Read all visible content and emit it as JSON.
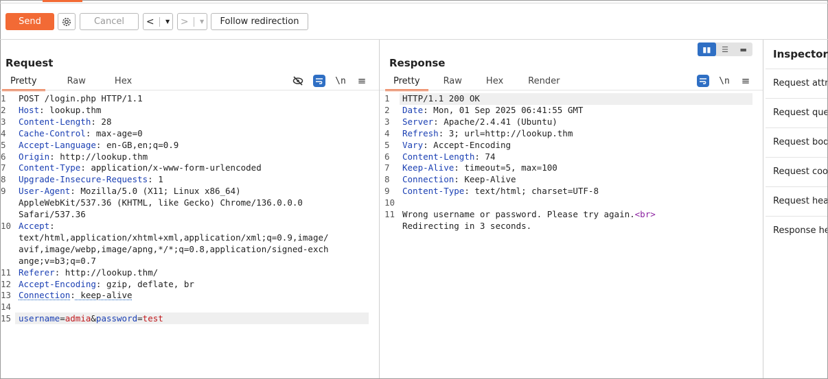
{
  "toolbar": {
    "send_label": "Send",
    "cancel_label": "Cancel",
    "prev_label": "<",
    "next_label": ">",
    "follow_label": "Follow redirection"
  },
  "request": {
    "title": "Request",
    "tabs": [
      "Pretty",
      "Raw",
      "Hex"
    ],
    "icons": [
      "eye-slash-icon",
      "wrap-icon",
      "newline-icon",
      "menu-icon"
    ],
    "newline_label": "\\n",
    "lines": [
      {
        "num": "1",
        "text": "POST /login.php HTTP/1.1"
      },
      {
        "num": "2",
        "key": "Host",
        "value": " lookup.thm"
      },
      {
        "num": "3",
        "key": "Content-Length",
        "value": " 28"
      },
      {
        "num": "4",
        "key": "Cache-Control",
        "value": " max-age=0"
      },
      {
        "num": "5",
        "key": "Accept-Language",
        "value": " en-GB,en;q=0.9"
      },
      {
        "num": "6",
        "key": "Origin",
        "value": " http://lookup.thm"
      },
      {
        "num": "7",
        "key": "Content-Type",
        "value": " application/x-www-form-urlencoded"
      },
      {
        "num": "8",
        "key": "Upgrade-Insecure-Requests",
        "value": " 1"
      },
      {
        "num": "9",
        "key": "User-Agent",
        "value": " Mozilla/5.0 (X11; Linux x86_64)"
      },
      {
        "num": "",
        "text": "AppleWebKit/537.36 (KHTML, like Gecko) Chrome/136.0.0.0"
      },
      {
        "num": "",
        "text": "Safari/537.36"
      },
      {
        "num": "10",
        "key": "Accept",
        "value": ""
      },
      {
        "num": "",
        "text": "text/html,application/xhtml+xml,application/xml;q=0.9,image/"
      },
      {
        "num": "",
        "text": "avif,image/webp,image/apng,*/*;q=0.8,application/signed-exch"
      },
      {
        "num": "",
        "text": "ange;v=b3;q=0.7"
      },
      {
        "num": "11",
        "key": "Referer",
        "value": " http://lookup.thm/"
      },
      {
        "num": "12",
        "key": "Accept-Encoding",
        "value": " gzip, deflate, br"
      },
      {
        "num": "13",
        "key": "Connection",
        "value": " keep-alive"
      },
      {
        "num": "14",
        "text": ""
      },
      {
        "num": "15",
        "body": [
          {
            "k": "username",
            "v": "admia"
          },
          {
            "k": "password",
            "v": "test"
          }
        ]
      }
    ]
  },
  "response": {
    "title": "Response",
    "tabs": [
      "Pretty",
      "Raw",
      "Hex",
      "Render"
    ],
    "icons": [
      "wrap-icon",
      "newline-icon",
      "menu-icon"
    ],
    "newline_label": "\\n",
    "lines": [
      {
        "num": "1",
        "text": "HTTP/1.1 200 OK"
      },
      {
        "num": "2",
        "key": "Date",
        "value": " Mon, 01 Sep 2025 06:41:55 GMT"
      },
      {
        "num": "3",
        "key": "Server",
        "value": " Apache/2.4.41 (Ubuntu)"
      },
      {
        "num": "4",
        "key": "Refresh",
        "value": " 3; url=http://lookup.thm"
      },
      {
        "num": "5",
        "key": "Vary",
        "value": " Accept-Encoding"
      },
      {
        "num": "6",
        "key": "Content-Length",
        "value": " 74"
      },
      {
        "num": "7",
        "key": "Keep-Alive",
        "value": " timeout=5, max=100"
      },
      {
        "num": "8",
        "key": "Connection",
        "value": " Keep-Alive"
      },
      {
        "num": "9",
        "key": "Content-Type",
        "value": " text/html; charset=UTF-8"
      },
      {
        "num": "10",
        "text": ""
      },
      {
        "num": "11",
        "text": "Wrong username or password. Please try again.",
        "tag": "<br>"
      },
      {
        "num": "",
        "text": "Redirecting in 3 seconds."
      }
    ]
  },
  "inspector": {
    "title": "Inspector",
    "items": [
      "Request attributes",
      "Request query parameters",
      "Request body parameters",
      "Request cookies",
      "Request headers",
      "Response headers"
    ]
  },
  "colors": {
    "accent": "#f26a35",
    "blue": "#2f6fc4",
    "header_key": "#1a3fb3",
    "param_value": "#c0181c"
  }
}
